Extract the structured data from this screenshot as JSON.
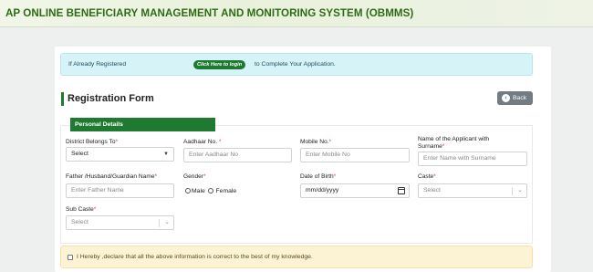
{
  "header": {
    "title": "AP ONLINE BENEFICIARY MANAGEMENT AND MONITORING SYSTEM (OBMMS)"
  },
  "info": {
    "prefix": "If Already Registered",
    "button": "Click Here to login",
    "suffix": "to Complete Your Application."
  },
  "form": {
    "title": "Registration Form",
    "back": "Back",
    "section": "Personal Details"
  },
  "fields": {
    "district": {
      "label": "District Belongs To",
      "value": "Select"
    },
    "aadhaar": {
      "label": "Aadhaar No. ",
      "placeholder": "Enter Aadhaar No"
    },
    "mobile": {
      "label": "Mobile No.",
      "placeholder": "Enter Mobile No"
    },
    "applicant": {
      "label_line1": "Name of the Applicant with",
      "label_line2": "Surname",
      "placeholder": "Enter Name with Surname"
    },
    "father": {
      "label": "Father /Husband/Guardian Name",
      "placeholder": "Enter Father Name"
    },
    "gender": {
      "label": "Gender",
      "options": [
        "Male",
        "Female"
      ]
    },
    "dob": {
      "label": "Date of Birth",
      "value": "mm/dd/yyyy"
    },
    "caste": {
      "label": "Caste",
      "value": "Select"
    },
    "subcaste": {
      "label": "Sub Caste",
      "value": "Select"
    }
  },
  "required_marker": "*",
  "declaration": "I Hereby ,declare that all the above information is correct to the best of my knowledge.",
  "colors": {
    "brand_green": "#1f7a31",
    "title_green": "#2f6a17",
    "required": "#d23b3b"
  }
}
